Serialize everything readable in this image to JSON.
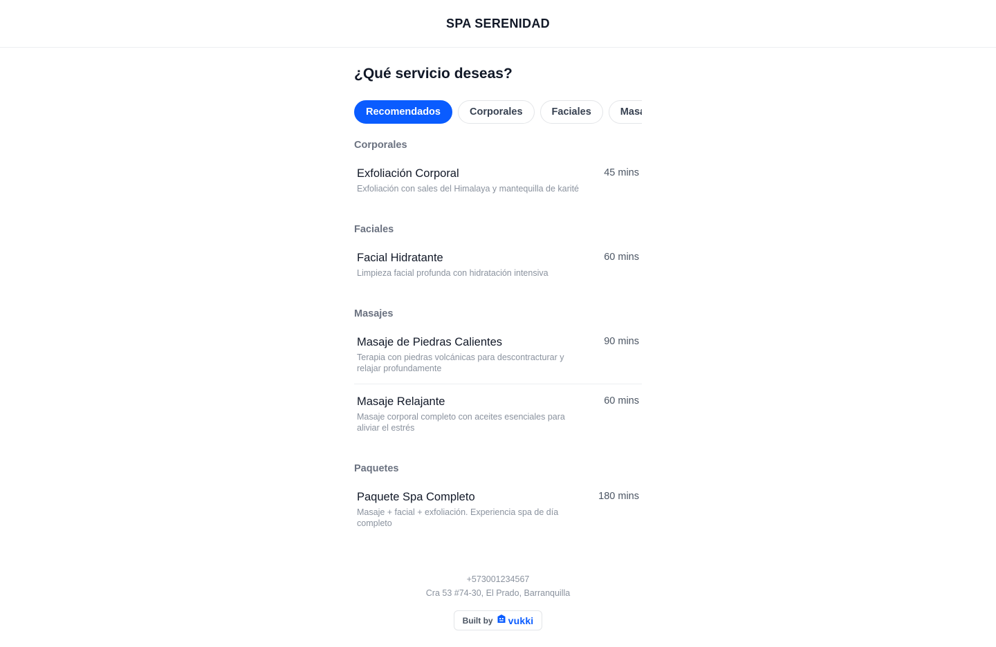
{
  "header": {
    "brand": "SPA SERENIDAD"
  },
  "main": {
    "title": "¿Qué servicio deseas?",
    "tabs": [
      {
        "label": "Recomendados",
        "active": true
      },
      {
        "label": "Corporales",
        "active": false
      },
      {
        "label": "Faciales",
        "active": false
      },
      {
        "label": "Masajes",
        "active": false
      }
    ],
    "sections": [
      {
        "title": "Corporales",
        "services": [
          {
            "name": "Exfoliación Corporal",
            "description": "Exfoliación con sales del Himalaya y mantequilla de karité",
            "duration": "45 mins"
          }
        ]
      },
      {
        "title": "Faciales",
        "services": [
          {
            "name": "Facial Hidratante",
            "description": "Limpieza facial profunda con hidratación intensiva",
            "duration": "60 mins"
          }
        ]
      },
      {
        "title": "Masajes",
        "services": [
          {
            "name": "Masaje de Piedras Calientes",
            "description": "Terapia con piedras volcánicas para descontracturar y relajar profundamente",
            "duration": "90 mins"
          },
          {
            "name": "Masaje Relajante",
            "description": "Masaje corporal completo con aceites esenciales para aliviar el estrés",
            "duration": "60 mins"
          }
        ]
      },
      {
        "title": "Paquetes",
        "services": [
          {
            "name": "Paquete Spa Completo",
            "description": "Masaje + facial + exfoliación. Experiencia spa de día completo",
            "duration": "180 mins"
          }
        ]
      }
    ]
  },
  "footer": {
    "phone": "+573001234567",
    "address": "Cra 53 #74-30, El Prado, Barranquilla",
    "built_by_label": "Built by",
    "built_by_brand": "vukki",
    "brand_icon": "vukki-logo-icon"
  },
  "colors": {
    "accent": "#0a5cff",
    "text": "#111827",
    "muted": "#8a929e"
  }
}
